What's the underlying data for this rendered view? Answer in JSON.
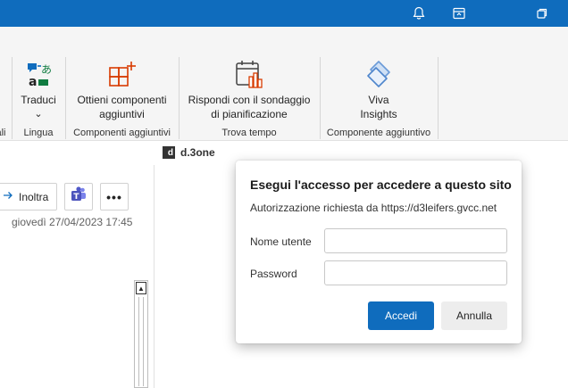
{
  "titlebar": {
    "accent": "#0f6cbd",
    "icons": [
      "bell-icon",
      "ribbon-display-icon",
      "restore-icon"
    ]
  },
  "ribbon": {
    "groups": [
      {
        "label": "ali"
      },
      {
        "label": "Lingua",
        "button": "Traduci",
        "button_arrow": "⌄"
      },
      {
        "label": "Componenti aggiuntivi",
        "button_line1": "Ottieni componenti",
        "button_line2": "aggiuntivi"
      },
      {
        "label": "Trova tempo",
        "button_line1": "Rispondi con il sondaggio",
        "button_line2": "di pianificazione"
      },
      {
        "label": "Componente aggiuntivo",
        "button_line1": "Viva",
        "button_line2": "Insights"
      }
    ]
  },
  "addin": {
    "name": "d.3one",
    "logo": "d"
  },
  "message": {
    "forward_label": "Inoltra",
    "more_label": "•••",
    "date": "giovedì 27/04/2023 17:45"
  },
  "dialog": {
    "title": "Esegui l'accesso per accedere a questo sito",
    "subtitle": "Autorizzazione richiesta da https://d3leifers.gvcc.net",
    "username_label": "Nome utente",
    "username_value": "",
    "password_label": "Password",
    "password_value": "",
    "login_button": "Accedi",
    "cancel_button": "Annulla"
  }
}
